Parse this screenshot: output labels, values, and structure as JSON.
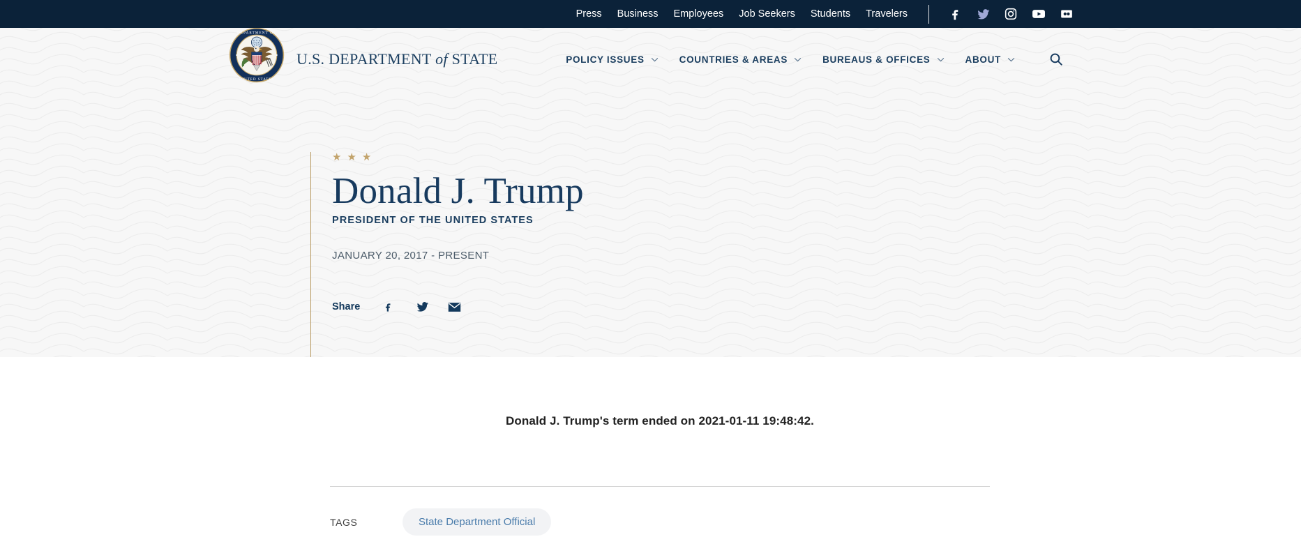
{
  "topbar": {
    "links": [
      {
        "label": "Press",
        "name": "press"
      },
      {
        "label": "Business",
        "name": "business"
      },
      {
        "label": "Employees",
        "name": "employees"
      },
      {
        "label": "Job Seekers",
        "name": "job-seekers"
      },
      {
        "label": "Students",
        "name": "students"
      },
      {
        "label": "Travelers",
        "name": "travelers"
      }
    ],
    "social": [
      {
        "icon": "facebook-icon"
      },
      {
        "icon": "twitter-icon"
      },
      {
        "icon": "instagram-icon"
      },
      {
        "icon": "youtube-icon"
      },
      {
        "icon": "flickr-icon"
      }
    ]
  },
  "brand": {
    "seal_alt": "great-seal-of-the-united-states",
    "line_pre": "U.S. DEPARTMENT ",
    "line_of": "of",
    "line_post": " STATE"
  },
  "mainnav": {
    "items": [
      {
        "label": "POLICY ISSUES",
        "name": "policy-issues"
      },
      {
        "label": "COUNTRIES & AREAS",
        "name": "countries-areas"
      },
      {
        "label": "BUREAUS & OFFICES",
        "name": "bureaus-offices"
      },
      {
        "label": "ABOUT",
        "name": "about"
      }
    ],
    "search_icon": "search-icon"
  },
  "hero": {
    "stars": [
      "★",
      "★",
      "★"
    ],
    "name": "Donald J. Trump",
    "role": "PRESIDENT OF THE UNITED STATES",
    "dates": "JANUARY 20, 2017 - PRESENT",
    "share_label": "Share",
    "share_icons": [
      {
        "icon": "facebook-icon"
      },
      {
        "icon": "twitter-icon"
      },
      {
        "icon": "email-icon"
      }
    ]
  },
  "article": {
    "body": "Donald J. Trump's term ended on 2021-01-11 19:48:42."
  },
  "tags": {
    "label": "TAGS",
    "items": [
      {
        "label": "State Department Official"
      }
    ]
  },
  "colors": {
    "navy": "#0b2239",
    "brand_blue": "#1c3f60",
    "gold": "#c2a36b",
    "tag_text": "#4a7cab",
    "tag_bg": "#f2f3f5",
    "hero_bg": "#f7f7f7"
  }
}
